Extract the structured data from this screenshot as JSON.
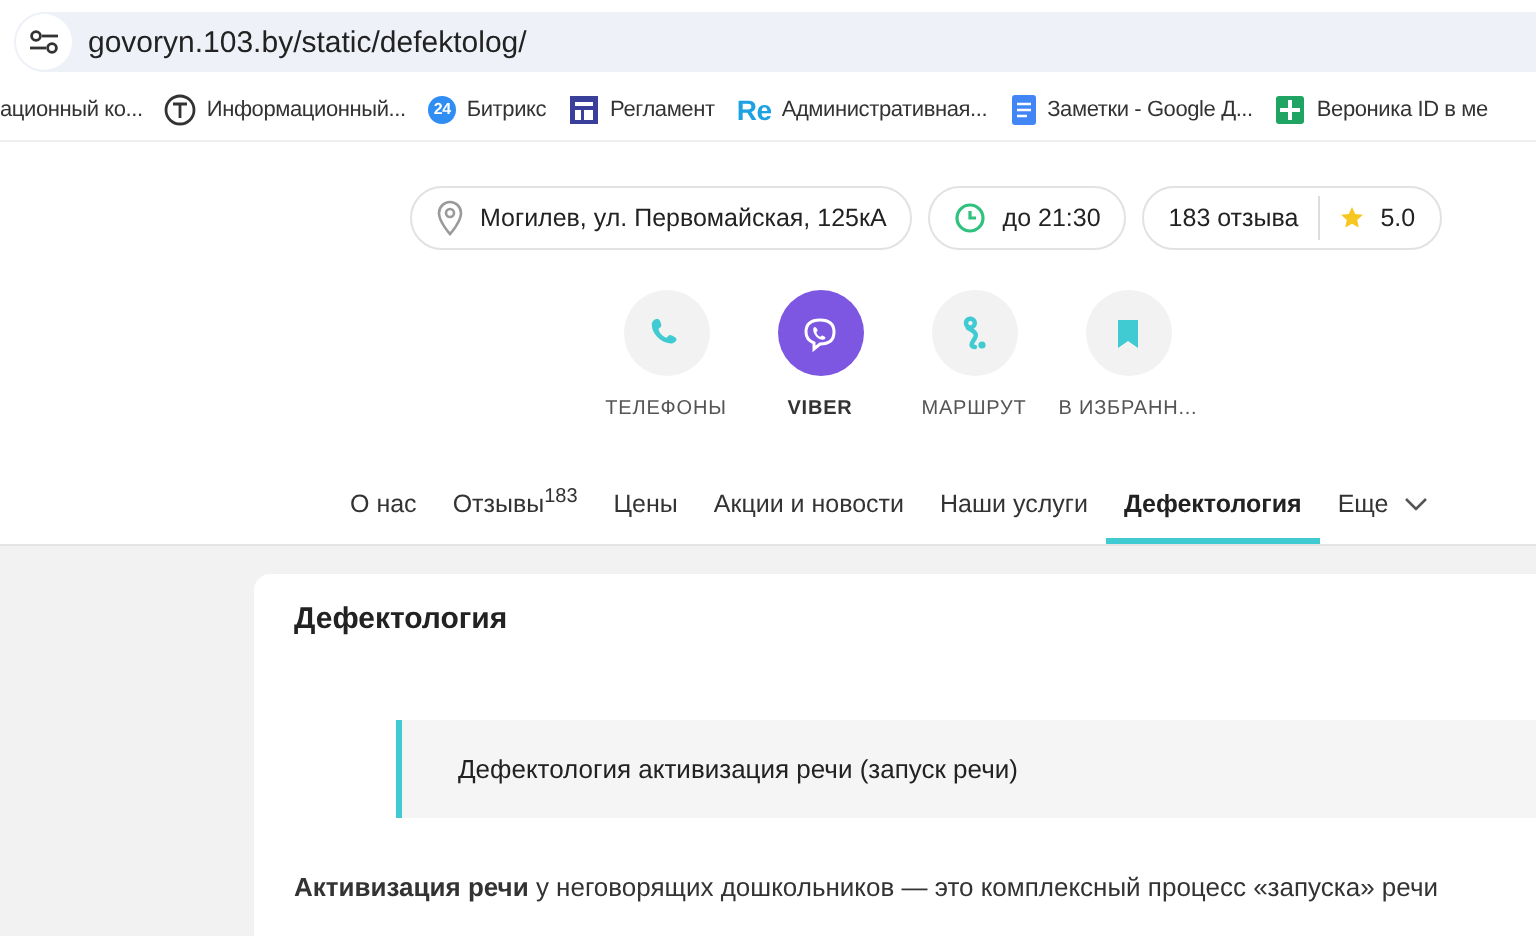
{
  "browser": {
    "url": "govoryn.103.by/static/defektolog/",
    "bookmarks": [
      {
        "kind": "plain",
        "label": "ационный ко..."
      },
      {
        "kind": "circle-t",
        "label": "Информационный..."
      },
      {
        "kind": "cloud",
        "logo": "24",
        "label": "Битрикс"
      },
      {
        "kind": "layout",
        "label": "Регламент"
      },
      {
        "kind": "text-logo",
        "logo": "Re",
        "label": "Административная..."
      },
      {
        "kind": "doc",
        "label": "Заметки - Google Д..."
      },
      {
        "kind": "sheet",
        "label": "Вероника ID в ме"
      }
    ]
  },
  "info": {
    "address": "Могилев, ул. Первомайская, 125кА",
    "hours": "до 21:30",
    "reviews": "183 отзыва",
    "rating": "5.0"
  },
  "actions": [
    {
      "kind": "phone",
      "label": "ТЕЛЕФОНЫ"
    },
    {
      "kind": "viber",
      "label": "VIBER"
    },
    {
      "kind": "route",
      "label": "МАРШРУТ"
    },
    {
      "kind": "bookmark",
      "label": "В ИЗБРАНН..."
    }
  ],
  "nav": [
    {
      "kind": "link",
      "label": "О нас",
      "selected": false
    },
    {
      "kind": "link",
      "label": "Отзывы",
      "count": "183",
      "selected": false
    },
    {
      "kind": "link",
      "label": "Цены",
      "selected": false
    },
    {
      "kind": "link",
      "label": "Акции и новости",
      "selected": false
    },
    {
      "kind": "link",
      "label": "Наши услуги",
      "selected": false
    },
    {
      "kind": "link",
      "label": "Дефектология",
      "selected": true
    },
    {
      "kind": "more",
      "label": "Еще",
      "selected": false
    }
  ],
  "content": {
    "title": "Дефектология",
    "quote": "Дефектология активизация речи (запуск речи)",
    "paragraph": "**Активизация речи** у неговорящих дошкольников — это комплексный процесс «запуска» речи"
  }
}
